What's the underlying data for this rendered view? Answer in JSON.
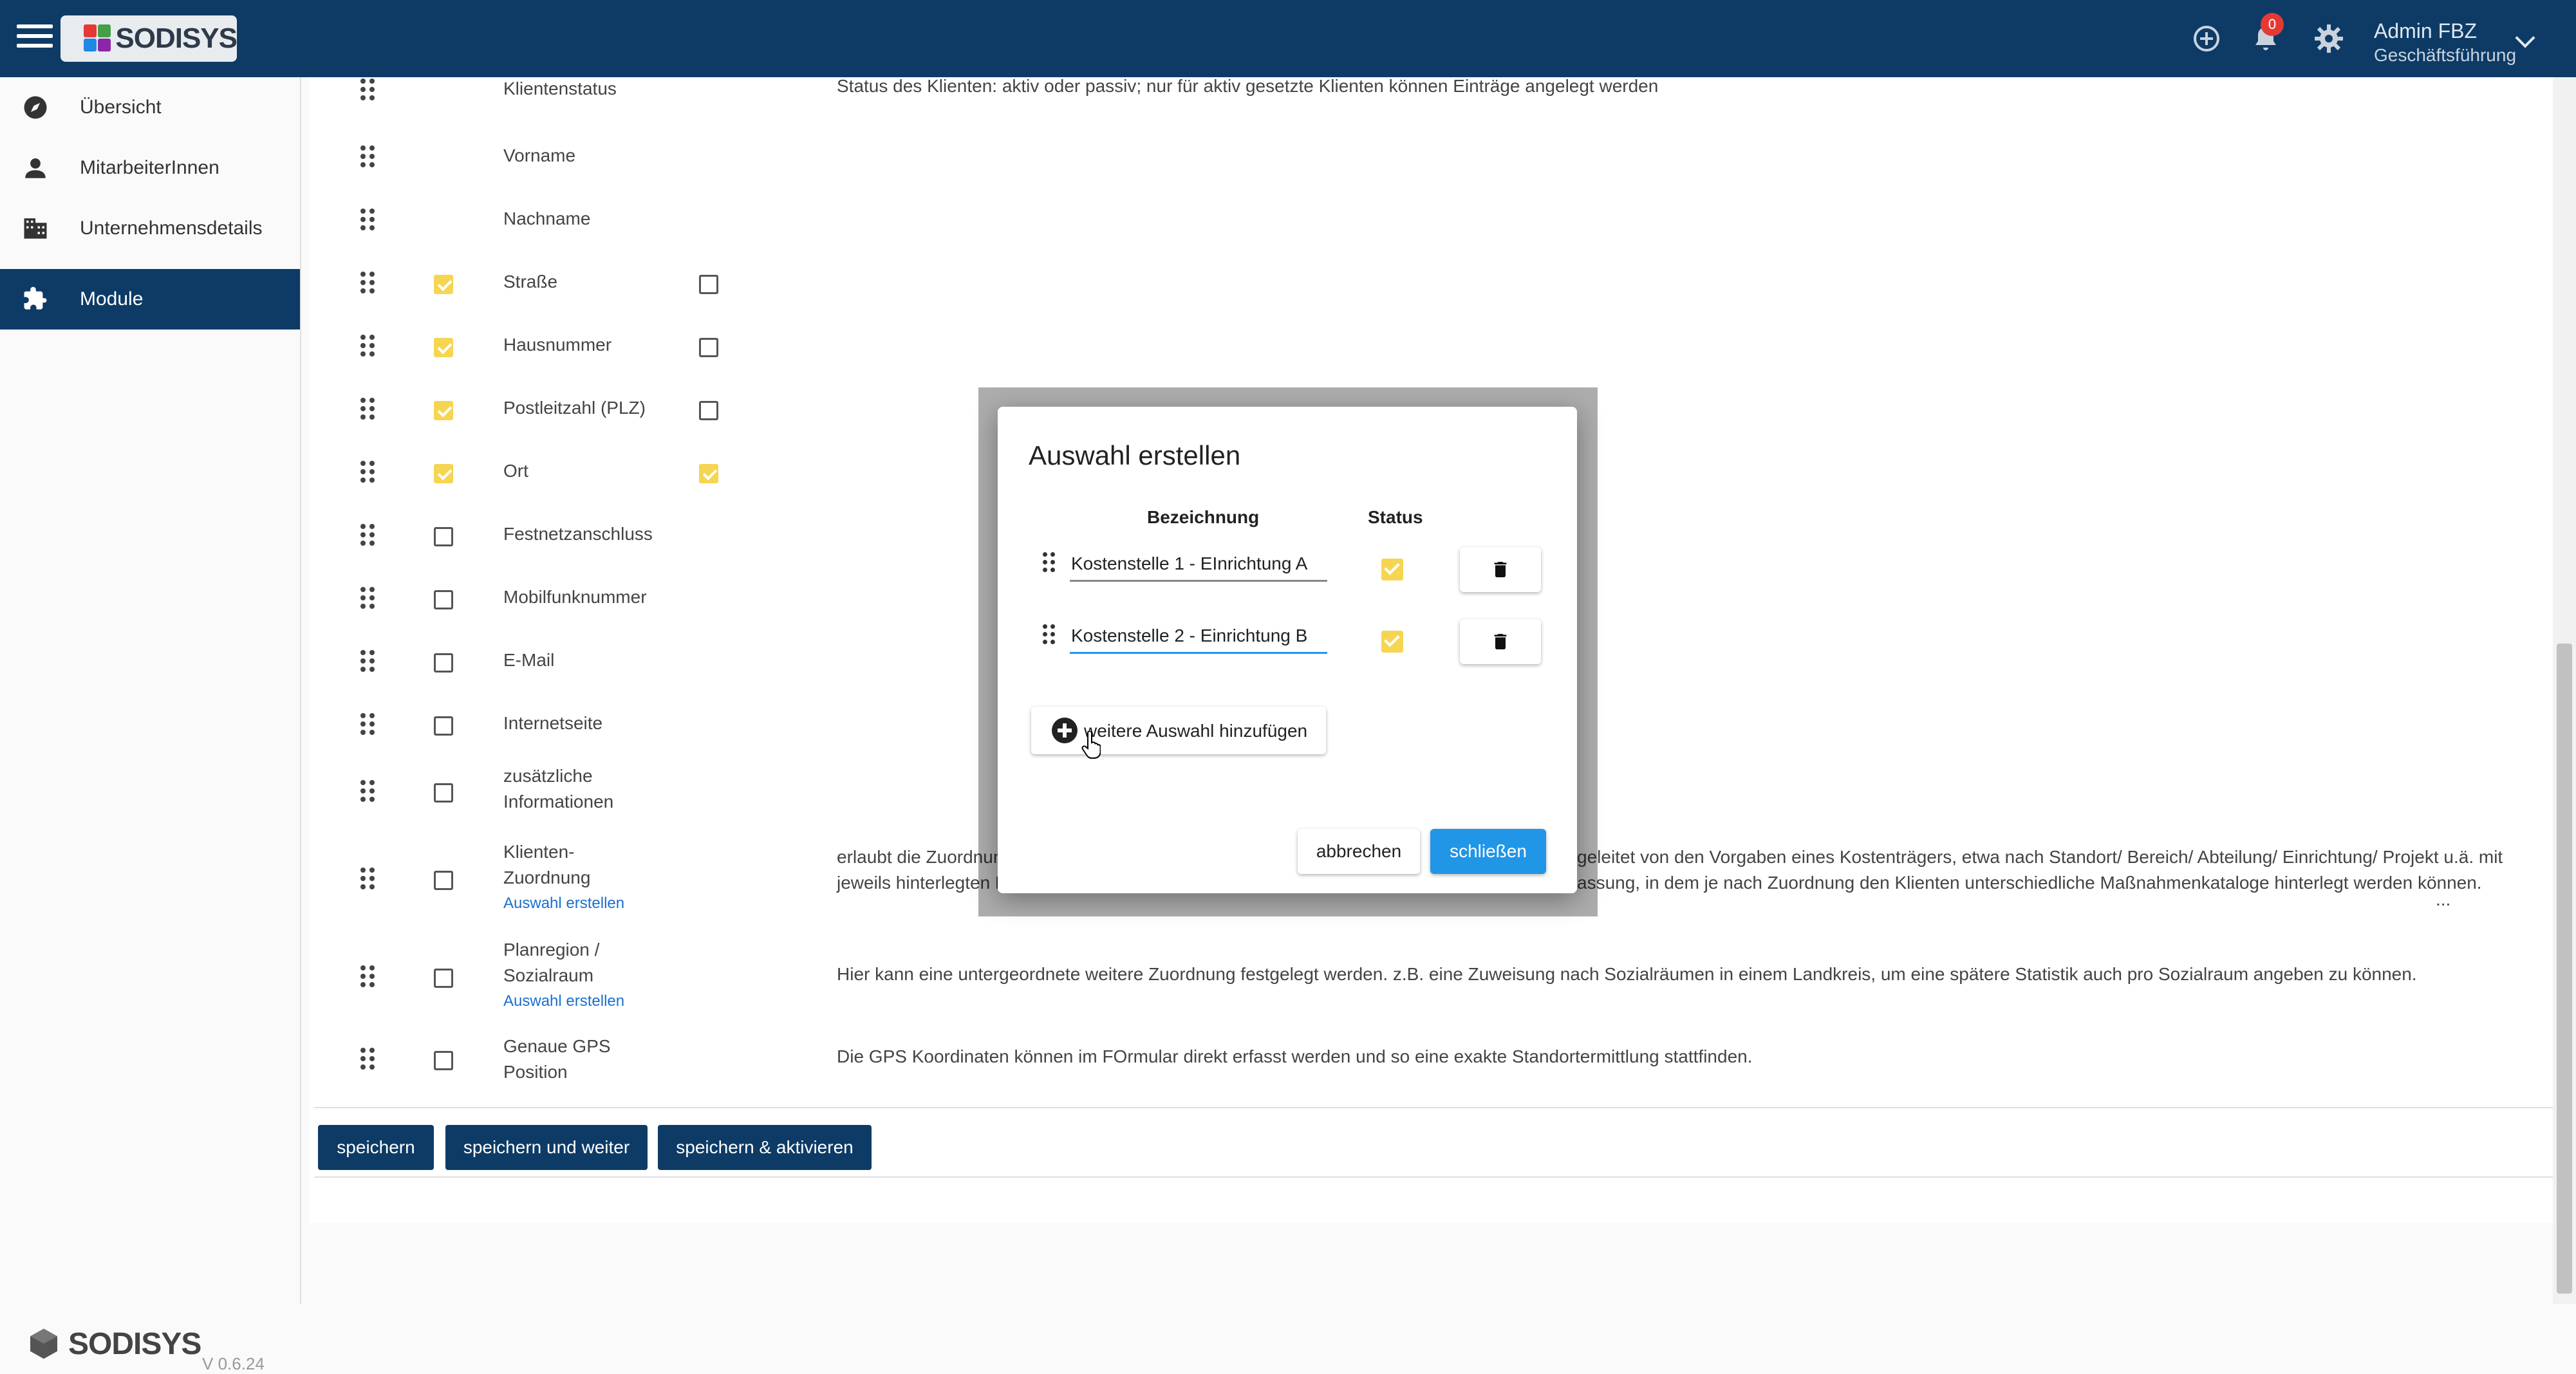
{
  "app": {
    "name": "SODISYS",
    "version": "V 0.6.24"
  },
  "header": {
    "notification_count": "0",
    "user_name": "Admin FBZ",
    "user_role": "Geschäftsführung"
  },
  "sidebar": {
    "items": [
      {
        "label": "Übersicht",
        "icon": "compass-icon"
      },
      {
        "label": "MitarbeiterInnen",
        "icon": "person-icon"
      },
      {
        "label": "Unternehmensdetails",
        "icon": "building-icon"
      },
      {
        "label": "Module",
        "icon": "puzzle-icon",
        "active": true
      }
    ]
  },
  "fields": [
    {
      "label": "Klientenstatus",
      "checked": null,
      "checked2": null,
      "desc": "Status des Klienten: aktiv oder passiv; nur für aktiv gesetzte Klienten können Einträge angelegt werden"
    },
    {
      "label": "Vorname",
      "checked": null,
      "checked2": null
    },
    {
      "label": "Nachname",
      "checked": null,
      "checked2": null
    },
    {
      "label": "Straße",
      "checked": true,
      "checked2": false
    },
    {
      "label": "Hausnummer",
      "checked": true,
      "checked2": false
    },
    {
      "label": "Postleitzahl (PLZ)",
      "checked": true,
      "checked2": false
    },
    {
      "label": "Ort",
      "checked": true,
      "checked2": true
    },
    {
      "label": "Festnetzanschluss",
      "checked": false,
      "checked2": null
    },
    {
      "label": "Mobilfunknummer",
      "checked": false,
      "checked2": null
    },
    {
      "label": "E-Mail",
      "checked": false,
      "checked2": null
    },
    {
      "label": "Internetseite",
      "checked": false,
      "checked2": null
    },
    {
      "label_line1": "zusätzliche",
      "label_line2": "Informationen",
      "checked": false,
      "checked2": null
    },
    {
      "label_line1": "Klienten-",
      "label_line2": "Zuordnung",
      "link": "Auswahl erstellen",
      "checked": false,
      "checked2": null,
      "desc_left": "erlaubt die Zuordnun",
      "desc_left2": "jeweils hinterlegten M",
      "desc_right": "geleitet von den Vorgaben eines Kostenträgers, etwa nach Standort/ Bereich/ Abteilung/ Einrichtung/ Projekt u.ä. mit",
      "desc_right2": "assung, in dem je nach Zuordnung den Klienten unterschiedliche Maßnahmenkataloge hinterlegt werden können.",
      "more": "..."
    },
    {
      "label_line1": "Planregion /",
      "label_line2": "Sozialraum",
      "link": "Auswahl erstellen",
      "checked": false,
      "checked2": null,
      "desc": "Hier kann eine untergeordnete weitere Zuordnung festgelegt werden. z.B. eine Zuweisung nach Sozialräumen in einem Landkreis, um eine spätere Statistik auch pro Sozialraum angeben zu können."
    },
    {
      "label_line1": "Genaue GPS",
      "label_line2": "Position",
      "checked": false,
      "checked2": null,
      "desc": "Die GPS Koordinaten können im FOrmular direkt erfasst werden und so eine exakte Standortermittlung stattfinden."
    }
  ],
  "actions": {
    "save": "speichern",
    "save_next": "speichern und weiter",
    "save_activate": "speichern & aktivieren"
  },
  "dialog": {
    "title": "Auswahl erstellen",
    "col_name": "Bezeichnung",
    "col_status": "Status",
    "rows": [
      {
        "value": "Kostenstelle 1 - EInrichtung A",
        "status": true
      },
      {
        "value": "Kostenstelle 2 - Einrichtung B",
        "status": true
      }
    ],
    "add_label": "weitere Auswahl hinzufügen",
    "cancel": "abbrechen",
    "close": "schließen"
  },
  "colors": {
    "primary": "#0d3b66",
    "accent": "#2196e6",
    "checkbox": "#f6d552"
  }
}
